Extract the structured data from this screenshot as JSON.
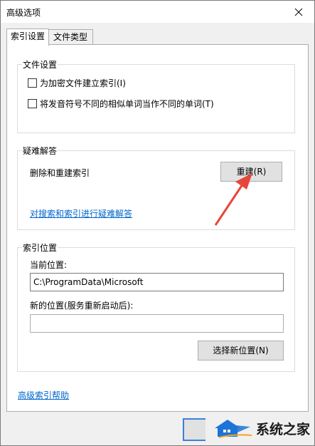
{
  "window": {
    "title": "高级选项"
  },
  "tabs": [
    {
      "label": "索引设置",
      "active": true
    },
    {
      "label": "文件类型",
      "active": false
    }
  ],
  "file_settings": {
    "title": "文件设置",
    "options": [
      {
        "label": "为加密文件建立索引(I)",
        "checked": false
      },
      {
        "label": "将发音符号不同的相似单词当作不同的单词(T)",
        "checked": false
      }
    ]
  },
  "troubleshooting": {
    "title": "疑难解答",
    "rebuild_label": "删除和重建索引",
    "rebuild_button": "重建(R)",
    "troubleshoot_link": "对搜索和索引进行疑难解答"
  },
  "index_location": {
    "title": "索引位置",
    "current_label": "当前位置:",
    "current_value": "C:\\ProgramData\\Microsoft",
    "new_label": "新的位置(服务重新启动后):",
    "new_value": "",
    "select_button": "选择新位置(N)"
  },
  "help_link": "高级索引帮助",
  "watermark": {
    "text": "系统之家"
  },
  "colors": {
    "link": "#0066cc",
    "arrow": "#e8463a",
    "accent": "#3c7fd8"
  }
}
